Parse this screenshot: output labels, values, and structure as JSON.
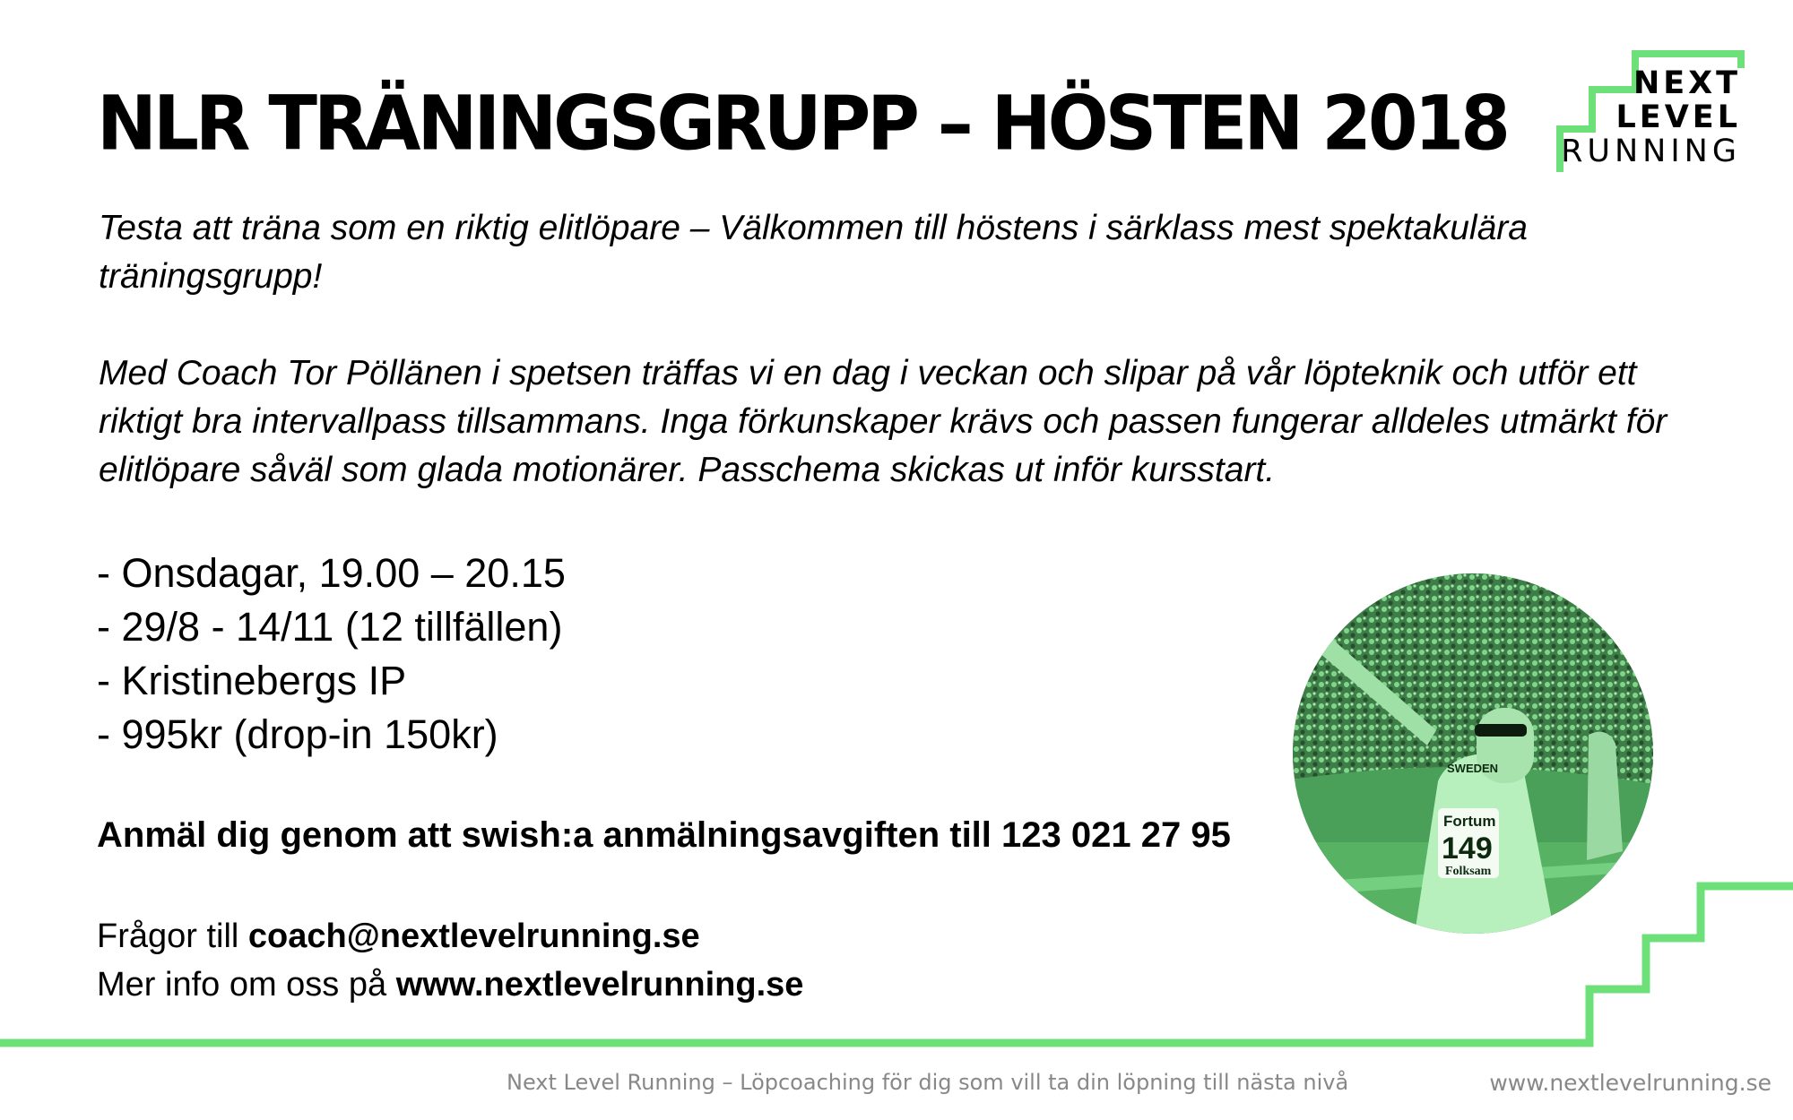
{
  "title": "NLR TRÄNINGSGRUPP – HÖSTEN 2018",
  "logo": {
    "line1": "NEXT",
    "line2": "LEVEL",
    "line3": "RUNNING"
  },
  "intro": {
    "p1": "Testa att träna som en riktig elitlöpare – Välkommen till höstens i särklass mest spektakulära träningsgrupp!",
    "p2": "Med Coach Tor Pöllänen i spetsen träffas vi en dag i veckan och slipar på vår löpteknik och utför ett riktigt bra intervallpass tillsammans. Inga förkunskaper krävs och passen fungerar alldeles utmärkt för elitlöpare såväl som glada motionärer. Passchema skickas ut inför kursstart."
  },
  "details": [
    "- Onsdagar, 19.00 – 20.15",
    "- 29/8 - 14/11 (12 tillfällen)",
    "- Kristinebergs IP",
    "- 995kr (drop-in 150kr)"
  ],
  "signup": "Anmäl dig genom att swish:a anmälningsavgiften till 123 021 27 95",
  "contact": {
    "questions_prefix": "Frågor till ",
    "email": "coach@nextlevelrunning.se",
    "info_prefix": "Mer info om oss på ",
    "website": "www.nextlevelrunning.se"
  },
  "photo": {
    "bib": {
      "sponsor": "Fortum",
      "number": "149",
      "sub": "Folksam"
    },
    "shirt": "SWEDEN"
  },
  "footer": {
    "tagline": "Next Level Running – Löpcoaching för dig som vill ta din löpning till nästa nivå",
    "url": "www.nextlevelrunning.se"
  },
  "colors": {
    "accent": "#6ee07a",
    "text": "#000000",
    "footer": "#888888",
    "photo_tint": "#62c472"
  }
}
